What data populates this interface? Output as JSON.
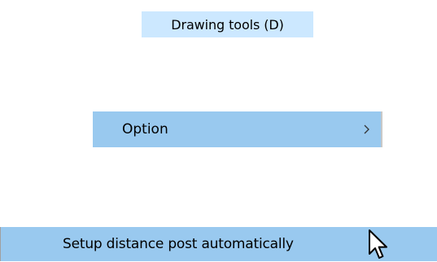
{
  "menu": {
    "header_label": "Drawing tools (D)",
    "option_label": "Option",
    "option_submenu_icon": "chevron-right-icon",
    "setup_label": "Setup distance post automatically"
  },
  "cursor": {
    "icon": "mouse-pointer-icon"
  },
  "colors": {
    "header_background": "#cce8ff",
    "highlight_background": "#99c9ef"
  }
}
